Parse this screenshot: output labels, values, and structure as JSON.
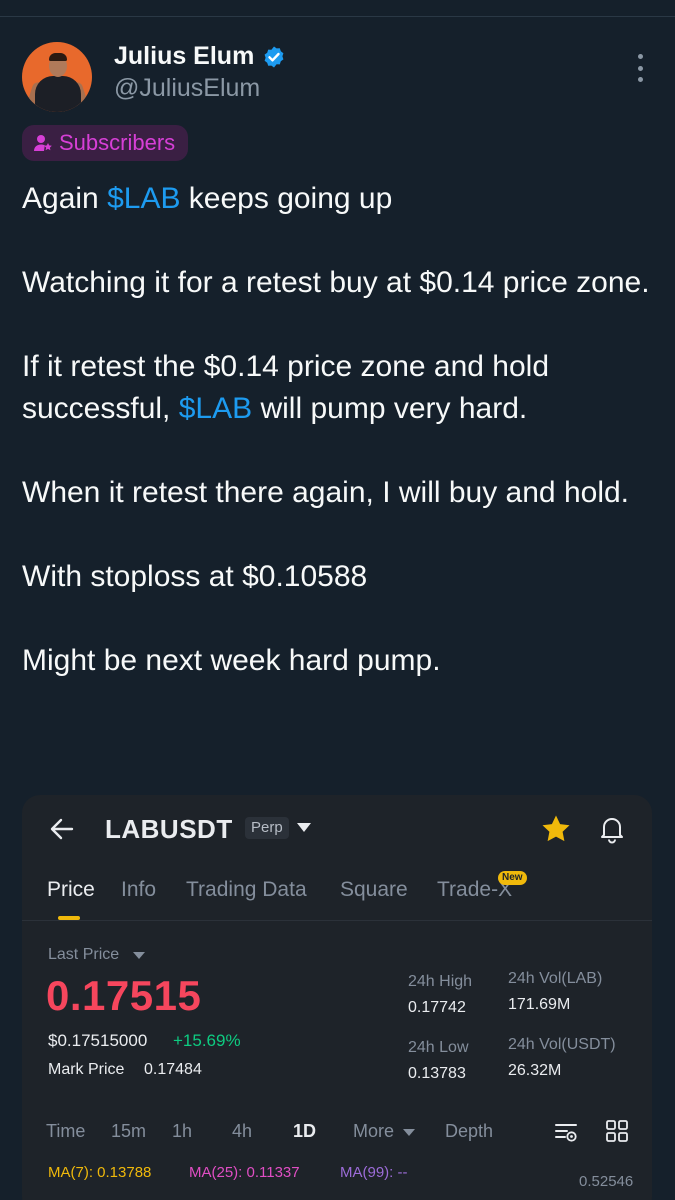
{
  "post": {
    "author_name": "Julius Elum",
    "author_handle": "@JuliusElum",
    "badge_label": "Subscribers",
    "paragraphs": {
      "p1_before": "Again ",
      "p1_tag": "$LAB",
      "p1_after": " keeps going up",
      "p2": "Watching it for a retest buy at $0.14 price zone.",
      "p3_before": "If it retest the $0.14 price zone and hold successful, ",
      "p3_tag": "$LAB",
      "p3_after": " will pump very hard.",
      "p4": "When it retest there again, I will buy and hold.",
      "p5": "With stoploss at $0.10588",
      "p6": "Might be next week hard pump."
    }
  },
  "colors": {
    "background": "#15202b",
    "cashtag": "#1d9bf0",
    "verified": "#1d9bf0",
    "badge_text": "#d63fd6",
    "price_red": "#f6465d",
    "change_green": "#0ecb81",
    "accent_yellow": "#f0b90b"
  },
  "icons": [
    "verified-badge-icon",
    "more-options-icon",
    "subscriber-icon",
    "back-arrow-icon",
    "dropdown-caret-icon",
    "star-icon",
    "bell-icon",
    "chart-settings-icon",
    "grid-layout-icon"
  ],
  "trade_card": {
    "pair": "LABUSDT",
    "contract_tag": "Perp",
    "tabs": [
      {
        "label": "Price",
        "active": true
      },
      {
        "label": "Info"
      },
      {
        "label": "Trading Data"
      },
      {
        "label": "Square"
      },
      {
        "label": "Trade-X"
      }
    ],
    "new_tag": "New",
    "last_price_label": "Last Price",
    "last_price": "0.17515",
    "usd_price": "$0.17515000",
    "change_pct": "+15.69%",
    "mark_price_label": "Mark Price",
    "mark_price": "0.17484",
    "stats": {
      "high_label": "24h High",
      "high_value": "0.17742",
      "low_label": "24h Low",
      "low_value": "0.13783",
      "vol_base_label": "24h Vol(LAB)",
      "vol_base_value": "171.69M",
      "vol_quote_label": "24h Vol(USDT)",
      "vol_quote_value": "26.32M"
    },
    "timeframes": {
      "time": "Time",
      "m15": "15m",
      "h1": "1h",
      "h4": "4h",
      "d1": "1D",
      "more": "More",
      "depth": "Depth"
    },
    "active_timeframe": "1D",
    "ma": {
      "ma7": "MA(7): 0.13788",
      "ma25": "MA(25): 0.11337",
      "ma99": "MA(99): --"
    },
    "axis_top_value": "0.52546"
  }
}
